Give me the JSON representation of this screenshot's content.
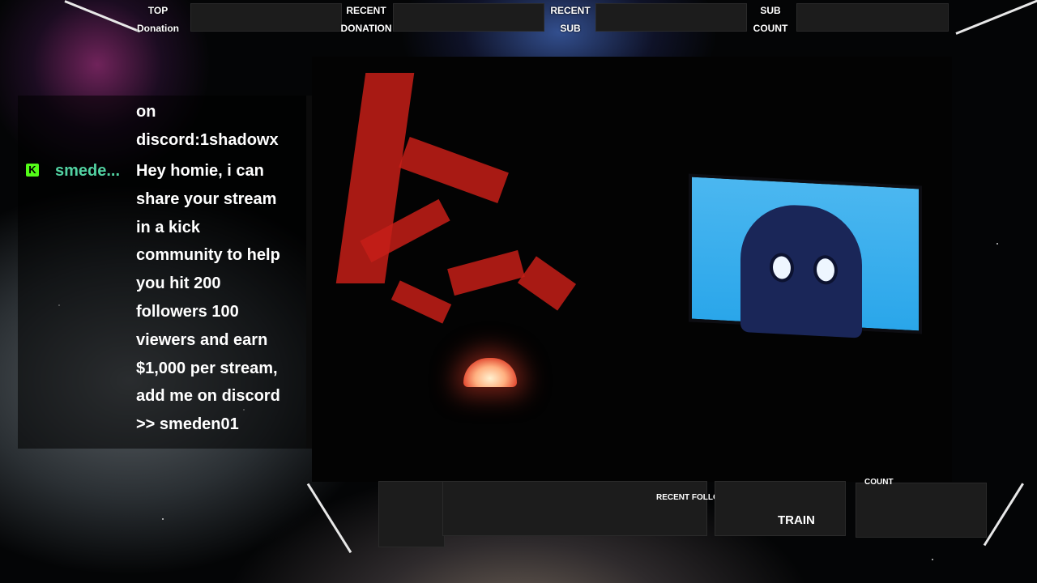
{
  "top_bar": {
    "top_donation_label": [
      "TOP",
      "Donation"
    ],
    "recent_donation_label": [
      "RECENT",
      "DONATION"
    ],
    "recent_sub_label": [
      "RECENT",
      "SUB"
    ],
    "sub_count_label": [
      "SUB",
      "COUNT"
    ]
  },
  "chat": {
    "prev_message_lines": [
      "on",
      "discord:1shadowx"
    ],
    "platform_icon": "kick-icon",
    "username": "smede...",
    "message_lines": [
      "Hey homie, i can",
      "share your stream",
      "in a kick",
      "community to help",
      "you hit 200",
      "followers 100",
      "viewers and earn",
      "$1,000 per stream,",
      "add me on discord",
      ">> smeden01"
    ],
    "username_color": "#52d2a2"
  },
  "bottom_bar": {
    "recent_follower_label": "RECENT FOLLOWER",
    "train_label": "TRAIN",
    "count_label": "COUNT"
  }
}
